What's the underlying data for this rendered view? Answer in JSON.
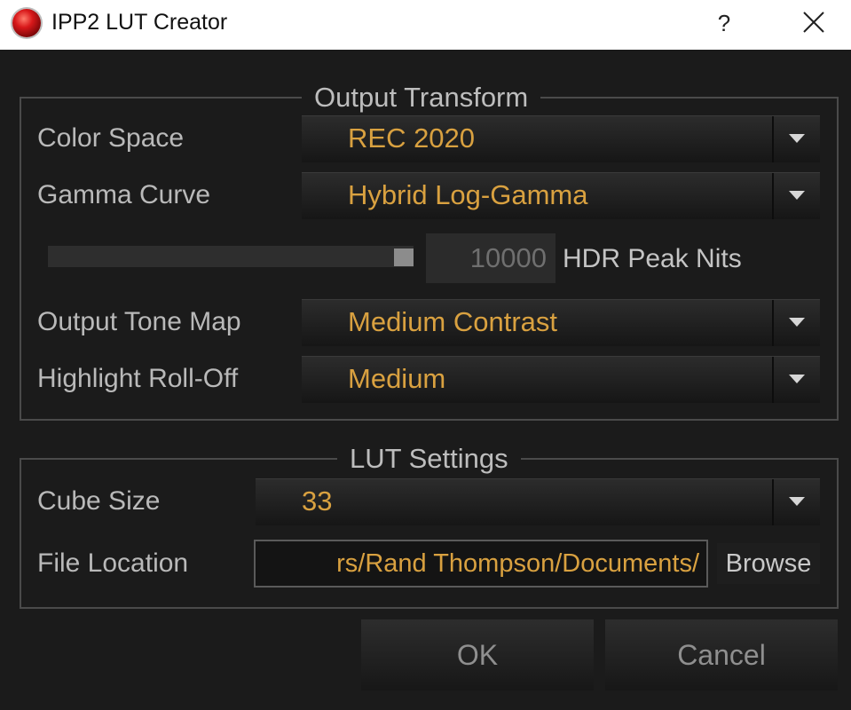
{
  "window": {
    "title": "IPP2 LUT Creator",
    "app_icon": "red-orb-icon",
    "help_label": "?",
    "close_icon": "close-icon"
  },
  "output_transform": {
    "title": "Output Transform",
    "color_space": {
      "label": "Color Space",
      "value": "REC 2020"
    },
    "gamma_curve": {
      "label": "Gamma Curve",
      "value": "Hybrid Log-Gamma"
    },
    "hdr_peak_nits": {
      "label": "HDR Peak Nits",
      "value": "10000",
      "slider_fraction": 1.0
    },
    "output_tone_map": {
      "label": "Output Tone Map",
      "value": "Medium Contrast"
    },
    "highlight_rolloff": {
      "label": "Highlight Roll-Off",
      "value": "Medium"
    }
  },
  "lut_settings": {
    "title": "LUT Settings",
    "cube_size": {
      "label": "Cube Size",
      "value": "33"
    },
    "file_location": {
      "label": "File Location",
      "value": "rs/Rand Thompson/Documents/",
      "browse_label": "Browse"
    }
  },
  "buttons": {
    "ok": "OK",
    "cancel": "Cancel"
  },
  "colors": {
    "accent": "#d9a140",
    "background": "#1b1b1b",
    "label": "#b9b9b9"
  }
}
